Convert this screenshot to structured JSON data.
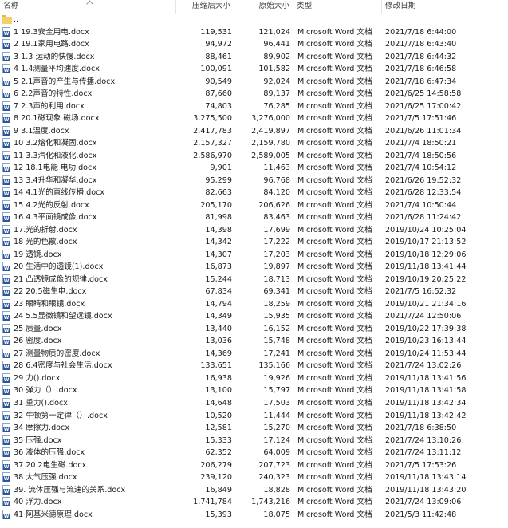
{
  "columns": {
    "name": "名称",
    "packed": "压缩后大小",
    "size": "原始大小",
    "type": "类型",
    "modified": "修改日期"
  },
  "parent_label": "..",
  "word_badge": "W",
  "rows": [
    {
      "name": "1 19.3安全用电.docx",
      "packed": "119,531",
      "size": "121,024",
      "type": "Microsoft Word 文档",
      "date": "2021/7/18 6:44:00"
    },
    {
      "name": "2 19.1家用电路.docx",
      "packed": "94,972",
      "size": "96,441",
      "type": "Microsoft Word 文档",
      "date": "2021/7/18 6:43:40"
    },
    {
      "name": "3 1.3 运动的快慢.docx",
      "packed": "88,461",
      "size": "89,902",
      "type": "Microsoft Word 文档",
      "date": "2021/7/18 6:44:32"
    },
    {
      "name": "4 1.4测量平均速度.docx",
      "packed": "100,091",
      "size": "101,582",
      "type": "Microsoft Word 文档",
      "date": "2021/7/18 6:46:58"
    },
    {
      "name": "5 2.1声音的产生与传播.docx",
      "packed": "90,549",
      "size": "92,024",
      "type": "Microsoft Word 文档",
      "date": "2021/7/18 6:47:34"
    },
    {
      "name": "6 2.2声音的特性.docx",
      "packed": "87,660",
      "size": "89,137",
      "type": "Microsoft Word 文档",
      "date": "2021/6/25 14:58:58"
    },
    {
      "name": "7 2.3声的利用.docx",
      "packed": "74,803",
      "size": "76,285",
      "type": "Microsoft Word 文档",
      "date": "2021/6/25 17:00:42"
    },
    {
      "name": "8 20.1磁现象 磁场.docx",
      "packed": "3,275,500",
      "size": "3,276,000",
      "type": "Microsoft Word 文档",
      "date": "2021/7/5 17:51:46"
    },
    {
      "name": "9 3.1温度.docx",
      "packed": "2,417,783",
      "size": "2,419,897",
      "type": "Microsoft Word 文档",
      "date": "2021/6/26 11:01:34"
    },
    {
      "name": "10 3.2熔化和凝固.docx",
      "packed": "2,157,327",
      "size": "2,159,780",
      "type": "Microsoft Word 文档",
      "date": "2021/7/4 18:50:21"
    },
    {
      "name": "11 3.3汽化和液化.docx",
      "packed": "2,586,970",
      "size": "2,589,005",
      "type": "Microsoft Word 文档",
      "date": "2021/7/4 18:50:56"
    },
    {
      "name": "12 18.1电能 电功.docx",
      "packed": "9,901",
      "size": "11,463",
      "type": "Microsoft Word 文档",
      "date": "2021/7/4 10:54:12"
    },
    {
      "name": "13 3.4升华和凝华.docx",
      "packed": "95,299",
      "size": "96,768",
      "type": "Microsoft Word 文档",
      "date": "2021/6/26 19:52:32"
    },
    {
      "name": "14 4.1光的直线传播.docx",
      "packed": "82,663",
      "size": "84,120",
      "type": "Microsoft Word 文档",
      "date": "2021/6/28 12:33:54"
    },
    {
      "name": "15 4.2光的反射.docx",
      "packed": "205,170",
      "size": "206,626",
      "type": "Microsoft Word 文档",
      "date": "2021/7/4 10:50:44"
    },
    {
      "name": "16 4.3平面镜成像.docx",
      "packed": "81,998",
      "size": "83,463",
      "type": "Microsoft Word 文档",
      "date": "2021/6/28 11:24:42"
    },
    {
      "name": "17.光的折射.docx",
      "packed": "14,398",
      "size": "17,699",
      "type": "Microsoft Word 文档",
      "date": "2019/10/24 10:25:04"
    },
    {
      "name": "18 光的色散.docx",
      "packed": "14,342",
      "size": "17,222",
      "type": "Microsoft Word 文档",
      "date": "2019/10/17 21:13:52"
    },
    {
      "name": "19 透镜.docx",
      "packed": "14,307",
      "size": "17,203",
      "type": "Microsoft Word 文档",
      "date": "2019/10/18 12:29:06"
    },
    {
      "name": "20 生活中的透镜(1).docx",
      "packed": "16,873",
      "size": "19,897",
      "type": "Microsoft Word 文档",
      "date": "2019/11/18 13:41:44"
    },
    {
      "name": "21 凸透镜成像的规律.docx",
      "packed": "15,244",
      "size": "18,713",
      "type": "Microsoft Word 文档",
      "date": "2019/10/19 20:25:22"
    },
    {
      "name": "22 20.5磁生电.docx",
      "packed": "67,834",
      "size": "69,341",
      "type": "Microsoft Word 文档",
      "date": "2021/7/5 16:52:32"
    },
    {
      "name": "23 眼睛和眼镜.docx",
      "packed": "14,794",
      "size": "18,259",
      "type": "Microsoft Word 文档",
      "date": "2019/10/21 21:34:16"
    },
    {
      "name": "24 5.5显微镜和望远镜.docx",
      "packed": "14,349",
      "size": "15,935",
      "type": "Microsoft Word 文档",
      "date": "2021/7/24 12:50:06"
    },
    {
      "name": "25 质量.docx",
      "packed": "13,440",
      "size": "16,152",
      "type": "Microsoft Word 文档",
      "date": "2019/10/22 17:39:38"
    },
    {
      "name": "26 密度.docx",
      "packed": "13,036",
      "size": "15,748",
      "type": "Microsoft Word 文档",
      "date": "2019/10/23 16:13:44"
    },
    {
      "name": "27 测量物质的密度.docx",
      "packed": "14,369",
      "size": "17,241",
      "type": "Microsoft Word 文档",
      "date": "2019/10/24 11:53:44"
    },
    {
      "name": "28 6.4密度与社会生活.docx",
      "packed": "133,651",
      "size": "135,166",
      "type": "Microsoft Word 文档",
      "date": "2021/7/24 13:02:26"
    },
    {
      "name": "29 力().docx",
      "packed": "16,938",
      "size": "19,926",
      "type": "Microsoft Word 文档",
      "date": "2019/11/18 13:41:56"
    },
    {
      "name": "30 弹力（）.docx",
      "packed": "13,100",
      "size": "15,797",
      "type": "Microsoft Word 文档",
      "date": "2019/11/18 13:41:58"
    },
    {
      "name": "31 重力().docx",
      "packed": "14,648",
      "size": "17,503",
      "type": "Microsoft Word 文档",
      "date": "2019/11/18 13:42:34"
    },
    {
      "name": "32 牛顿第一定律（）.docx",
      "packed": "10,520",
      "size": "11,444",
      "type": "Microsoft Word 文档",
      "date": "2019/11/18 13:42:42"
    },
    {
      "name": "34 摩擦力.docx",
      "packed": "12,581",
      "size": "15,270",
      "type": "Microsoft Word 文档",
      "date": "2021/7/18 6:38:50"
    },
    {
      "name": "35 压强.docx",
      "packed": "15,333",
      "size": "17,124",
      "type": "Microsoft Word 文档",
      "date": "2021/7/24 13:10:26"
    },
    {
      "name": "36 液体的压强.docx",
      "packed": "62,352",
      "size": "64,009",
      "type": "Microsoft Word 文档",
      "date": "2021/7/24 13:11:12"
    },
    {
      "name": "37 20.2电生磁.docx",
      "packed": "206,279",
      "size": "207,723",
      "type": "Microsoft Word 文档",
      "date": "2021/7/5 17:53:26"
    },
    {
      "name": "38 大气压强.docx",
      "packed": "239,120",
      "size": "240,323",
      "type": "Microsoft Word 文档",
      "date": "2019/11/18 13:43:14"
    },
    {
      "name": "39. 流体压强与流速的关系.docx",
      "packed": "16,849",
      "size": "18,828",
      "type": "Microsoft Word 文档",
      "date": "2019/11/18 13:43:20"
    },
    {
      "name": "40 浮力.docx",
      "packed": "1,741,784",
      "size": "1,743,216",
      "type": "Microsoft Word 文档",
      "date": "2021/7/24 13:09:06"
    },
    {
      "name": "41 阿基米德原理.docx",
      "packed": "15,393",
      "size": "18,075",
      "type": "Microsoft Word 文档",
      "date": "2021/5/3 11:42:48"
    }
  ]
}
